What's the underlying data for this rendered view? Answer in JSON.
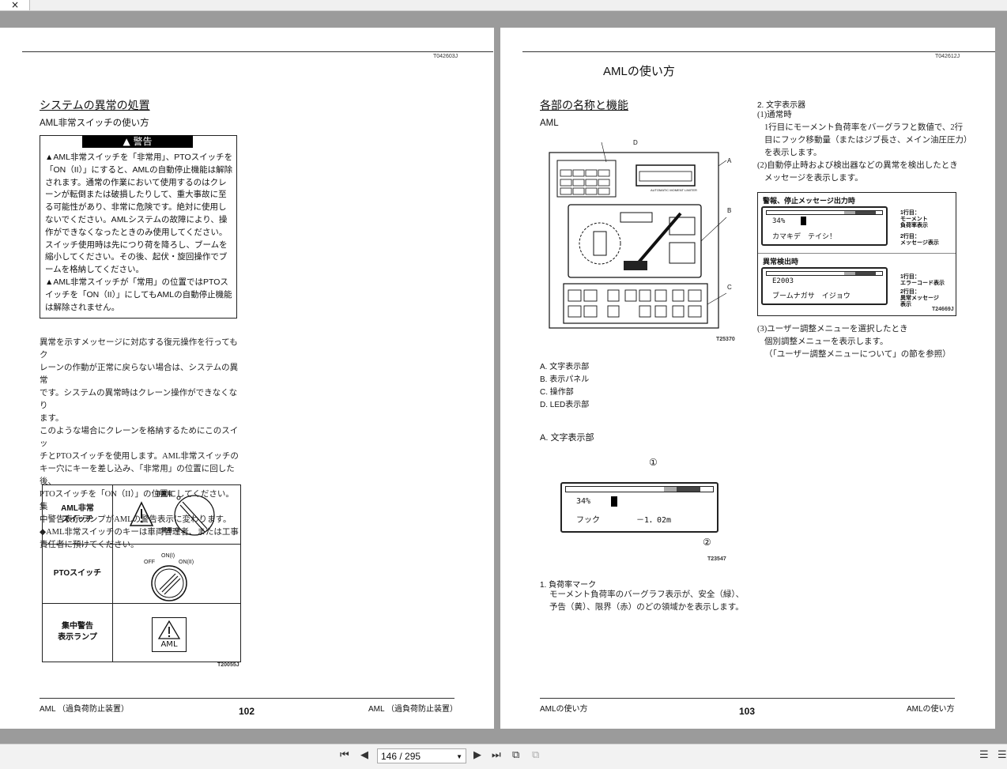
{
  "viewer": {
    "close_icon": "×",
    "current_page": "146 / 295",
    "icons": [
      "first-page-icon",
      "prev-page-icon",
      "dropdown-icon",
      "next-page-icon",
      "last-page-icon",
      "two-page-view-icon",
      "single-page-view-icon",
      "thumbnail-icon",
      "list-icon"
    ]
  },
  "left": {
    "code": "T042603J",
    "title": "システムの異常の処置",
    "subtitle": "AML非常スイッチの使い方",
    "warn_head": "▲ 警告",
    "warn_p1": "AML非常スイッチを「非常用」、PTOスイッチを「ON（II）」にすると、AMLの自動停止機能は解除されます。通常の作業において使用するのはクレーンが転倒または破損したりして、重大事故に至る可能性があり、非常に危険です。絶対に使用しないでください。AMLシステムの故障により、操作ができなくなったときのみ使用してください。スイッチ使用時は先につり荷を降ろし、ブームを縮小してください。その後、起伏・旋回操作でブームを格納してください。",
    "warn_p2": "AML非常スイッチが「常用」の位置ではPTOスイッチを「ON（II）」にしてもAMLの自動停止機能は解除されません。",
    "body_lines": [
      "異常を示すメッセージに対応する復元操作を行ってもク",
      "レーンの作動が正常に戻らない場合は、システムの異常",
      "です。システムの異常時はクレーン操作ができなくなり",
      "ます。",
      "このような場合にクレーンを格納するためにこのスイッ",
      "チとPTOスイッチを使用します。AML非常スイッチの",
      "キー穴にキーを差し込み、「非常用」の位置に回した後、",
      "PTOスイッチを「ON（II）」の位置にしてください。集",
      "中警告表示ランプがAMLの警告表示に変わります。",
      "◆AML非常スイッチのキーは車両管理者、または工事",
      "責任者に預けてください。"
    ],
    "table": {
      "row1_label": "AML非常\nスイッチ",
      "row1_emergency": "非常用",
      "row1_normal": "常用",
      "row2_label": "PTOスイッチ",
      "row2_off": "OFF",
      "row2_on1": "ON(I)",
      "row2_on2": "ON(II)",
      "row3_label": "集中警告\n表示ランプ",
      "row3_lamp": "AML"
    },
    "fig_code": "T20055J",
    "footer_left": "AML （過負荷防止装置）",
    "page_number": "102",
    "footer_right": "AML （過負荷防止装置）"
  },
  "right": {
    "code": "T042612J",
    "header": "AMLの使い方",
    "title": "各部の名称と機能",
    "subtitle": "AML",
    "panel_labels": {
      "a": "A",
      "b": "B",
      "c": "C",
      "d": "D"
    },
    "panel_brand": "AUTOMATIC MOMENT LIMITER",
    "panel_fig_code": "T25370",
    "parts": [
      "A. 文字表示部",
      "B. 表示パネル",
      "C. 操作部",
      "D. LED表示部"
    ],
    "section_a": "A. 文字表示部",
    "lcd_line1": "34%",
    "lcd_line2_left": "フック",
    "lcd_line2_right": "－1．02m",
    "callout1": "①",
    "callout2": "②",
    "lcd_fig_code": "T23547",
    "item1_title": "1. 負荷率マーク",
    "item1_lines": [
      "モーメント負荷率のバーグラフ表示が、安全（緑）、",
      "予告（黄）、限界（赤）のどの領域かを表示します。"
    ],
    "item2_title": "2. 文字表示器",
    "item2_normal": "(1)通常時",
    "item2_normal_lines": [
      "1行目にモーメント負荷率をバーグラフと数値で、2行",
      "目にフック移動量（またはジブ長さ、メイン油圧圧力）",
      "を表示します。"
    ],
    "item2_abnormal": "(2)自動停止時および検出器などの異常を検出したとき",
    "item2_abnormal_line": "メッセージを表示します。",
    "box1_title": "警報、停止メッセージ出力時",
    "box1_l1": "34%",
    "box1_l2": "カマキデ　テイシ！",
    "box1_note1": "1行目：\nモーメント\n負荷率表示",
    "box1_note2": "2行目：\nメッセージ表示",
    "box2_title": "異常検出時",
    "box2_l1": "E2003",
    "box2_l2": "ブームナガサ　イジョウ",
    "box2_note1": "1行目：\nエラーコード表示",
    "box2_note2": "2行目：\n異常メッセージ\n表示",
    "box_fig_code": "T24669J",
    "item3": "(3)ユーザー調整メニューを選択したとき",
    "item3_l1": "個別調整メニューを表示します。",
    "item3_l2": "（「ユーザー調整メニューについて」の節を参照）",
    "footer_left": "AMLの使い方",
    "page_number": "103",
    "footer_right": "AMLの使い方"
  }
}
